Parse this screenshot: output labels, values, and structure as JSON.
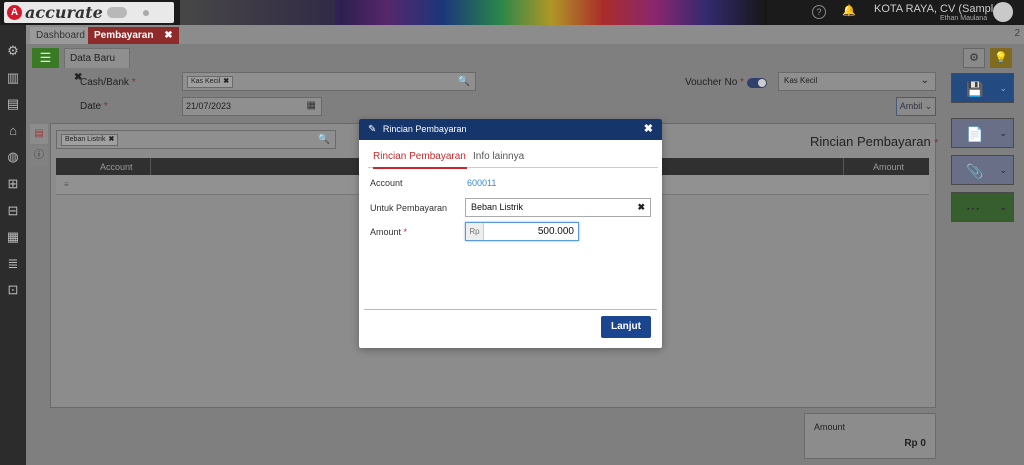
{
  "app": {
    "logo_letter": "A",
    "logo_text": "accurate",
    "company_name": "KOTA RAYA, CV (Sample)",
    "user_name": "Ethan Maulana"
  },
  "tabs": [
    {
      "label": "Dashboard"
    },
    {
      "label": "Pembayaran",
      "close": "✖"
    }
  ],
  "tab_count": "2",
  "subtab": {
    "label": "Data Baru",
    "close": "✖"
  },
  "form": {
    "cash_bank_label": "Cash/Bank",
    "cash_bank_value": "Kas Kecil",
    "voucher_label": "Voucher No",
    "voucher_value": "Kas Kecil",
    "date_label": "Date",
    "date_value": "21/07/2023",
    "ambil_label": "Ambil",
    "required_mark": "*",
    "chip_close": "✖",
    "filter_chip": "Beban Listrik"
  },
  "detail": {
    "title": "Rincian Pembayaran",
    "columns": [
      "Account",
      "Amount"
    ]
  },
  "total": {
    "label": "Amount",
    "value": "Rp 0"
  },
  "modal": {
    "title": "Rincian Pembayaran",
    "close": "✖",
    "tabs": [
      "Rincian Pembayaran",
      "Info lainnya"
    ],
    "account_label": "Account",
    "account_value": "600011",
    "untuk_label": "Untuk Pembayaran",
    "untuk_value": "Beban Listrik",
    "input_clear": "✖",
    "amount_label": "Amount",
    "amount_required": "*",
    "currency": "Rp",
    "amount_value": "500.000",
    "button_label": "Lanjut"
  },
  "icons": {
    "menu": "☰",
    "gear": "⚙",
    "bulb": "💡",
    "search": "🔍",
    "calendar": "▦",
    "save": "💾",
    "doc": "📄",
    "clip": "📎",
    "more": "⋯",
    "chevron": "⌄",
    "pencil": "✎",
    "drag": "≡",
    "help": "?",
    "bell": "🔔"
  },
  "colors": {
    "accent_red": "#c8282a",
    "modal_header": "#16356a",
    "primary_button": "#1c4590",
    "link_blue": "#3a8acc"
  }
}
